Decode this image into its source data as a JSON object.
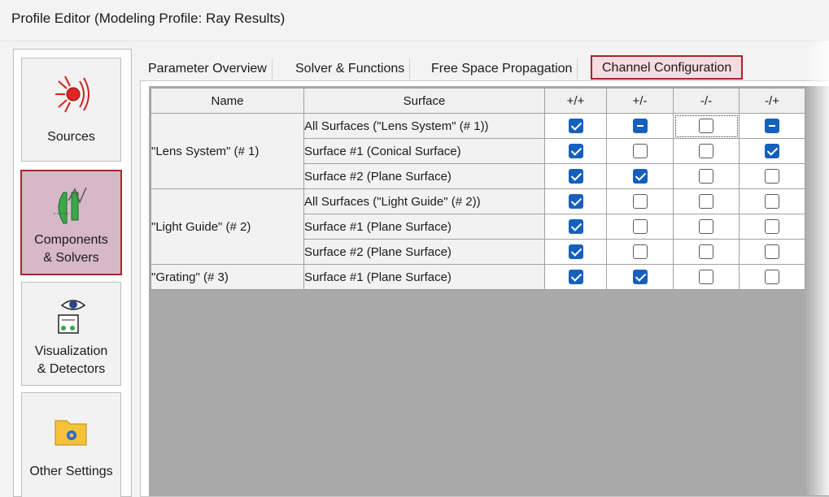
{
  "window": {
    "title": "Profile Editor (Modeling Profile: Ray Results)"
  },
  "nav": {
    "items": [
      {
        "id": "sources",
        "label1": "Sources",
        "label2": "",
        "icon": "light-source-icon",
        "selected": false
      },
      {
        "id": "components",
        "label1": "Components",
        "label2": "& Solvers",
        "icon": "lens-components-icon",
        "selected": true
      },
      {
        "id": "visualization",
        "label1": "Visualization",
        "label2": "& Detectors",
        "icon": "eye-detector-icon",
        "selected": false
      },
      {
        "id": "other",
        "label1": "Other Settings",
        "label2": "",
        "icon": "folder-gear-icon",
        "selected": false
      }
    ]
  },
  "tabs": [
    {
      "label": "Parameter Overview",
      "active": false
    },
    {
      "label": "Solver & Functions",
      "active": false
    },
    {
      "label": "Free Space Propagation",
      "active": false
    },
    {
      "label": "Channel Configuration",
      "active": true
    }
  ],
  "grid": {
    "columns": [
      "Name",
      "Surface",
      "+/+",
      "+/-",
      "-/-",
      "-/+"
    ],
    "groups": [
      {
        "name": "\"Lens System\" (# 1)",
        "rows": [
          {
            "surface": "All Surfaces (\"Lens System\" (# 1))",
            "states": [
              "checked",
              "partial",
              "unchecked",
              "partial"
            ],
            "focus": 2
          },
          {
            "surface": "Surface #1 (Conical Surface)",
            "states": [
              "checked",
              "unchecked",
              "unchecked",
              "checked"
            ]
          },
          {
            "surface": "Surface #2 (Plane Surface)",
            "states": [
              "checked",
              "checked",
              "unchecked",
              "unchecked"
            ]
          }
        ]
      },
      {
        "name": "\"Light Guide\" (# 2)",
        "rows": [
          {
            "surface": "All Surfaces (\"Light Guide\" (# 2))",
            "states": [
              "checked",
              "unchecked",
              "unchecked",
              "unchecked"
            ]
          },
          {
            "surface": "Surface #1 (Plane Surface)",
            "states": [
              "checked",
              "unchecked",
              "unchecked",
              "unchecked"
            ]
          },
          {
            "surface": "Surface #2 (Plane Surface)",
            "states": [
              "checked",
              "unchecked",
              "unchecked",
              "unchecked"
            ]
          }
        ]
      },
      {
        "name": "\"Grating\" (# 3)",
        "rows": [
          {
            "surface": "Surface #1 (Plane Surface)",
            "states": [
              "checked",
              "checked",
              "unchecked",
              "unchecked"
            ]
          }
        ]
      }
    ]
  },
  "colors": {
    "accent_border": "#a4262c",
    "selected_nav_bg": "#d7b8c6",
    "active_tab_bg": "#f6dbe0",
    "checkbox_blue": "#1560bd",
    "grid_background": "#a9a9a9"
  }
}
